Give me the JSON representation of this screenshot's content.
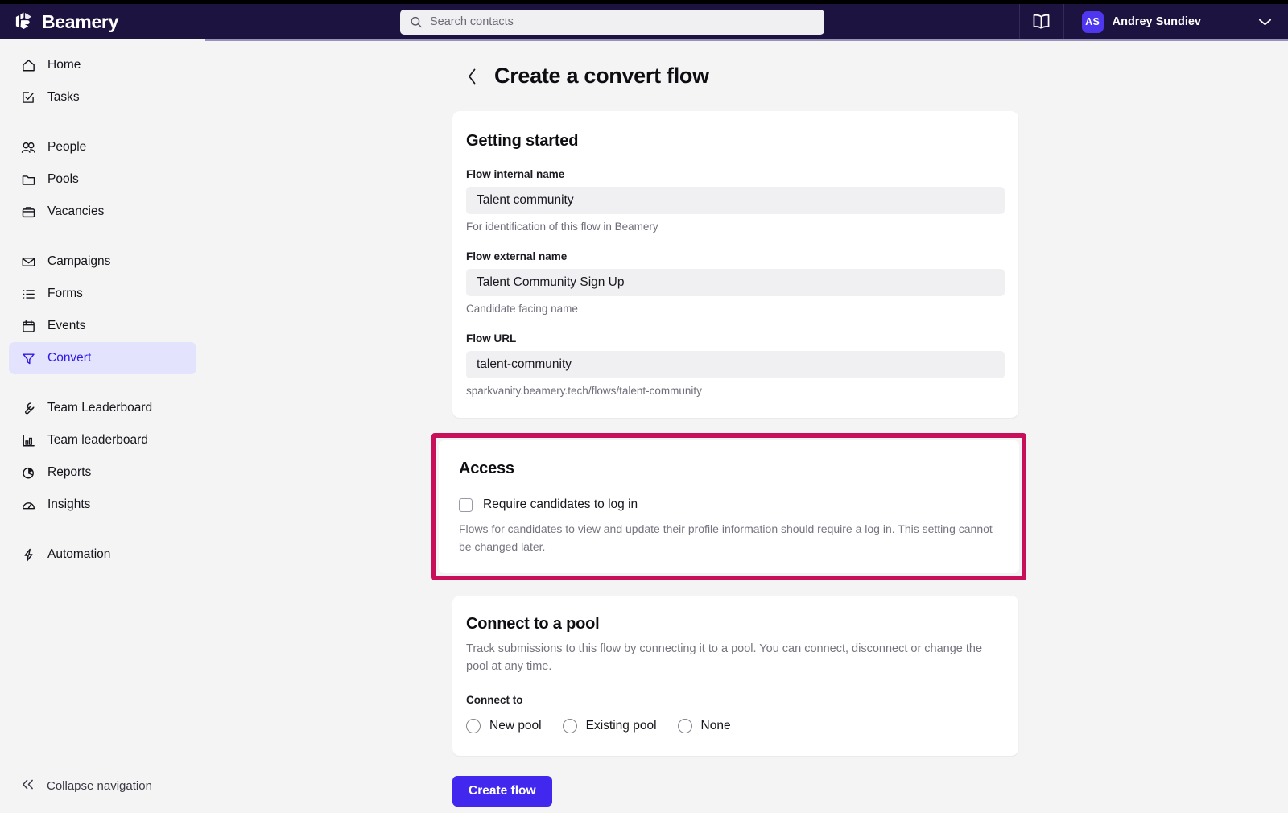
{
  "brand": {
    "name": "Beamery",
    "logo_icon": "beamery-cube-logo",
    "accent": "#4228ee",
    "header_bg": "#1d1340"
  },
  "header": {
    "search": {
      "placeholder": "Search contacts",
      "value": "",
      "icon": "search-icon"
    },
    "knowledge_icon": "book-icon",
    "user": {
      "initials": "AS",
      "name": "Andrey Sundiev",
      "chevron": "chevron-down-icon"
    }
  },
  "sidebar": {
    "items": [
      {
        "label": "Home",
        "icon": "home-icon",
        "active": false
      },
      {
        "label": "Tasks",
        "icon": "tasks-icon",
        "active": false
      },
      {
        "label": "People",
        "icon": "people-icon",
        "active": false
      },
      {
        "label": "Pools",
        "icon": "folder-icon",
        "active": false
      },
      {
        "label": "Vacancies",
        "icon": "briefcase-icon",
        "active": false
      },
      {
        "label": "Campaigns",
        "icon": "envelope-icon",
        "active": false
      },
      {
        "label": "Forms",
        "icon": "list-icon",
        "active": false
      },
      {
        "label": "Events",
        "icon": "calendar-icon",
        "active": false
      },
      {
        "label": "Convert",
        "icon": "funnel-icon",
        "active": true
      },
      {
        "label": "Team Leaderboard",
        "icon": "wrench-icon",
        "active": false
      },
      {
        "label": "Team leaderboard",
        "icon": "bar-chart-icon",
        "active": false
      },
      {
        "label": "Reports",
        "icon": "pie-chart-icon",
        "active": false
      },
      {
        "label": "Insights",
        "icon": "gauge-icon",
        "active": false
      },
      {
        "label": "Automation",
        "icon": "lightning-icon",
        "active": false
      }
    ],
    "collapse": {
      "label": "Collapse navigation",
      "icon": "double-chevron-left-icon"
    }
  },
  "page": {
    "back_icon": "chevron-left-icon",
    "title": "Create a convert flow"
  },
  "getting_started": {
    "heading": "Getting started",
    "fields": [
      {
        "label": "Flow internal name",
        "value": "Talent community",
        "helper": "For identification of this flow in Beamery"
      },
      {
        "label": "Flow external name",
        "value": "Talent Community Sign Up",
        "helper": "Candidate facing name"
      },
      {
        "label": "Flow URL",
        "value": "talent-community",
        "helper": "sparkvanity.beamery.tech/flows/talent-community"
      }
    ]
  },
  "access": {
    "heading": "Access",
    "checkbox_label": "Require candidates to log in",
    "checked": false,
    "help_text": "Flows for candidates to view and update their profile information should require a log in. This setting cannot be changed later.",
    "highlight_color": "#c8105a"
  },
  "connect_pool": {
    "heading": "Connect to a pool",
    "description": "Track submissions to this flow by connecting it to a pool. You can connect, disconnect or change the pool at any time.",
    "radio_label": "Connect to",
    "options": [
      {
        "label": "New pool",
        "selected": false
      },
      {
        "label": "Existing pool",
        "selected": false
      },
      {
        "label": "None",
        "selected": false
      }
    ]
  },
  "footer": {
    "submit_label": "Create flow"
  }
}
